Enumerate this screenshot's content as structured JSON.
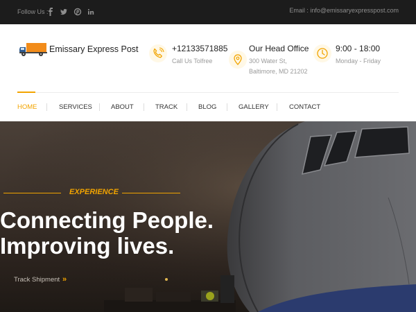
{
  "topbar": {
    "follow_label": "Follow Us :",
    "social": [
      "facebook-icon",
      "twitter-icon",
      "pinterest-icon",
      "linkedin-icon"
    ],
    "email": "Email : info@emissaryexpresspost.com"
  },
  "header": {
    "brand": "Emissary Express Post",
    "phone": {
      "title": "+12133571885",
      "sub": "Call Us Tolfree",
      "icon": "phone-icon"
    },
    "office": {
      "title": "Our Head Office",
      "sub_line1": "300 Water St,",
      "sub_line2": "Baltimore, MD 21202",
      "icon": "location-pin-icon"
    },
    "hours": {
      "title": "9:00 - 18:00",
      "sub": "Monday - Friday",
      "icon": "clock-icon"
    }
  },
  "nav": {
    "items": [
      "HOME",
      "SERVICES",
      "ABOUT",
      "TRACK",
      "BLOG",
      "GALLERY",
      "CONTACT"
    ],
    "active": "HOME"
  },
  "hero": {
    "eyebrow": "EXPERIENCE",
    "title_line1": "Connecting People.",
    "title_line2": "Improving lives.",
    "cta": "Track Shipment",
    "cta_arrow": "»"
  },
  "colors": {
    "accent": "#f2a400",
    "topbar": "#1c1c1c",
    "text": "#222222"
  }
}
